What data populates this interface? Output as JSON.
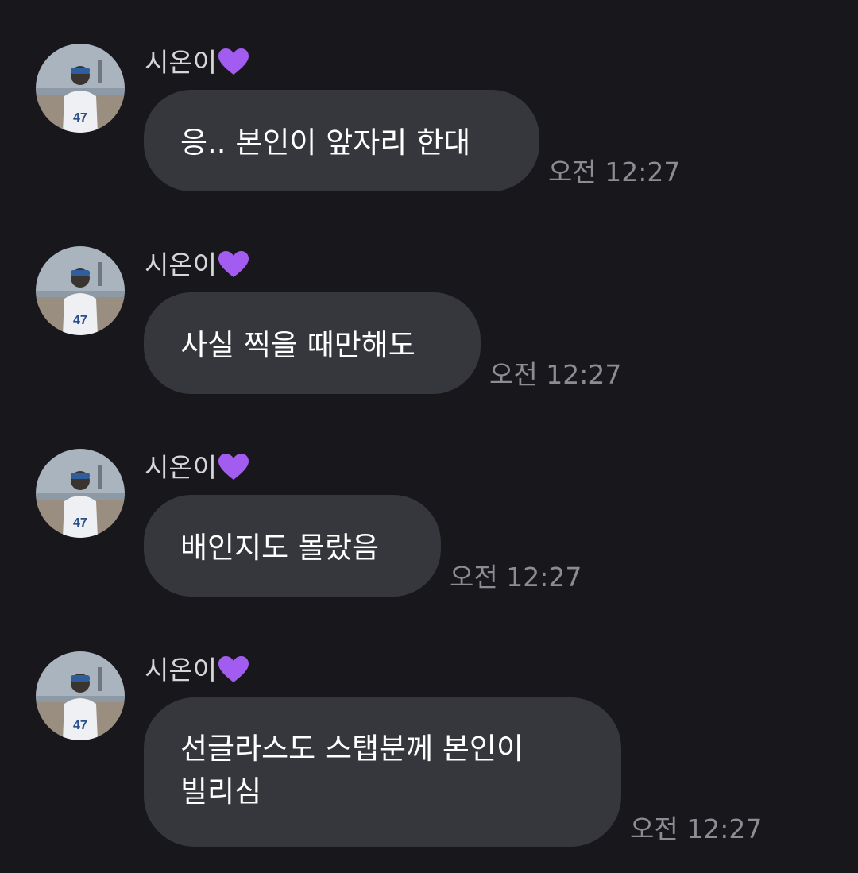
{
  "chat": {
    "messages": [
      {
        "sender": "시온이",
        "sender_icon": "purple-heart",
        "lines": [
          "응.. 본인이 앞자리 한대"
        ],
        "time": "오전 12:27"
      },
      {
        "sender": "시온이",
        "sender_icon": "purple-heart",
        "lines": [
          "사실 찍을 때만해도"
        ],
        "time": "오전 12:27"
      },
      {
        "sender": "시온이",
        "sender_icon": "purple-heart",
        "lines": [
          "배인지도 몰랐음"
        ],
        "time": "오전 12:27"
      },
      {
        "sender": "시온이",
        "sender_icon": "purple-heart",
        "lines": [
          "선글라스도 스탭분께 본인이",
          "빌리심"
        ],
        "time": "오전 12:27"
      }
    ]
  },
  "colors": {
    "background": "#18181c",
    "bubble": "#36373c",
    "sender_text": "#d6d6d9",
    "time_text": "#8c8c92",
    "heart": "#a35cf0"
  }
}
